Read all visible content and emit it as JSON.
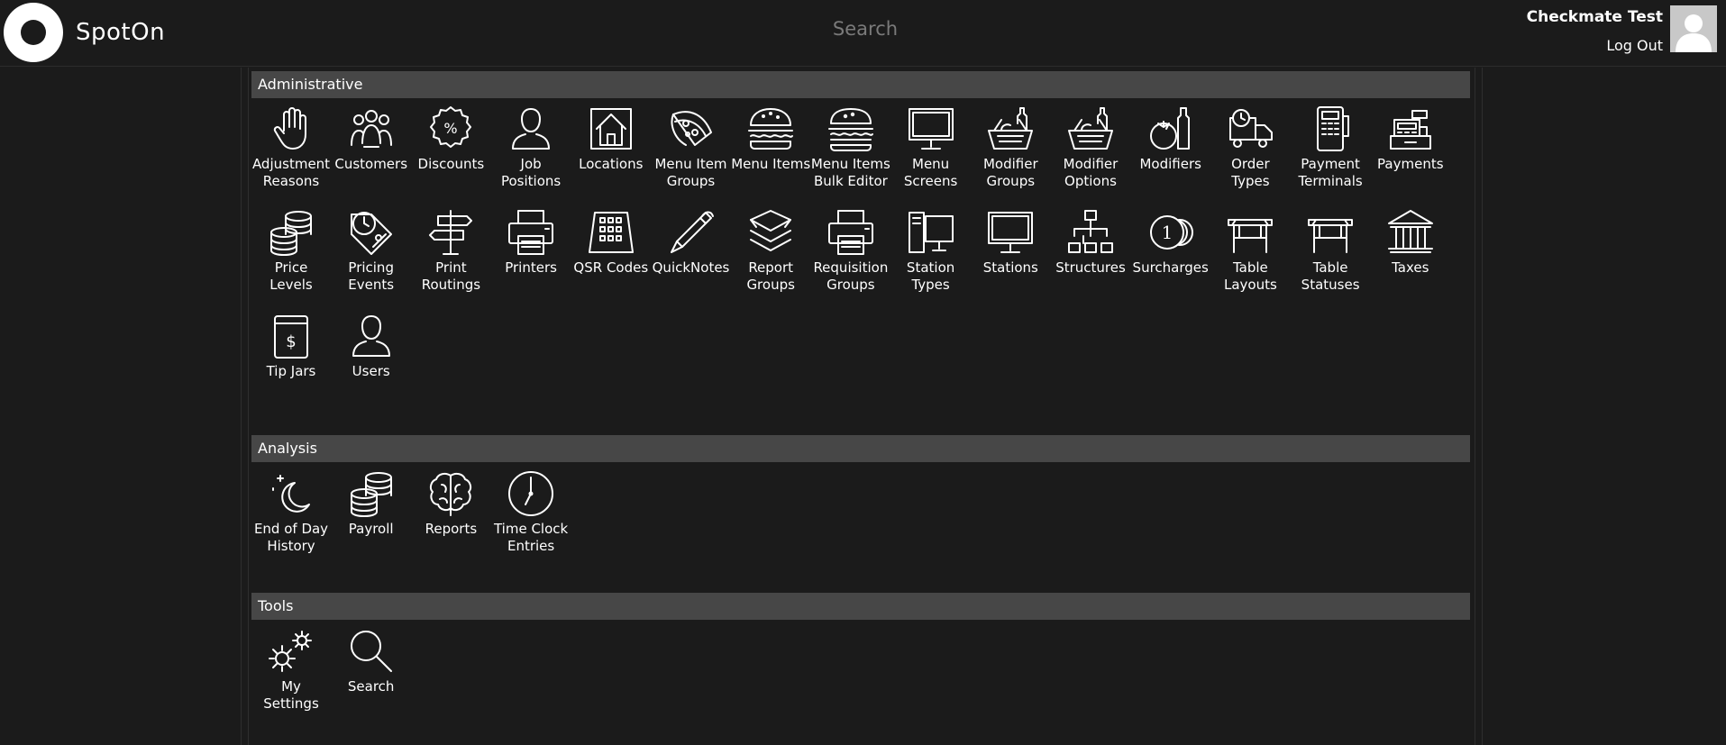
{
  "header": {
    "brand": "SpotOn",
    "search_placeholder": "Search",
    "user_name": "Checkmate Test",
    "logout_label": "Log Out"
  },
  "sections": {
    "administrative": {
      "title": "Administrative",
      "items": [
        {
          "label": "Adjustment\nReasons",
          "icon": "hand-icon"
        },
        {
          "label": "Customers",
          "icon": "customers-icon"
        },
        {
          "label": "Discounts",
          "icon": "discount-badge-icon"
        },
        {
          "label": "Job\nPositions",
          "icon": "person-icon"
        },
        {
          "label": "Locations",
          "icon": "house-icon"
        },
        {
          "label": "Menu Item\nGroups",
          "icon": "pizza-icon"
        },
        {
          "label": "Menu Items",
          "icon": "burger-icon"
        },
        {
          "label": "Menu Items\nBulk Editor",
          "icon": "burger-stack-icon"
        },
        {
          "label": "Menu\nScreens",
          "icon": "monitor-icon"
        },
        {
          "label": "Modifier\nGroups",
          "icon": "basket-bottle-icon"
        },
        {
          "label": "Modifier\nOptions",
          "icon": "basket-bottle-icon"
        },
        {
          "label": "Modifiers",
          "icon": "tomato-bottle-icon"
        },
        {
          "label": "Order Types",
          "icon": "delivery-truck-icon"
        },
        {
          "label": "Payment\nTerminals",
          "icon": "card-terminal-icon"
        },
        {
          "label": "Payments",
          "icon": "cash-register-icon"
        },
        {
          "label": "Price Levels",
          "icon": "coin-stack-icon"
        },
        {
          "label": "Pricing\nEvents",
          "icon": "price-tag-clock-icon"
        },
        {
          "label": "Print\nRoutings",
          "icon": "signpost-icon"
        },
        {
          "label": "Printers",
          "icon": "printer-icon"
        },
        {
          "label": "QSR Codes",
          "icon": "keypad-icon"
        },
        {
          "label": "QuickNotes",
          "icon": "pen-icon"
        },
        {
          "label": "Report\nGroups",
          "icon": "layers-icon"
        },
        {
          "label": "Requisition\nGroups",
          "icon": "printer-icon"
        },
        {
          "label": "Station\nTypes",
          "icon": "workstation-icon"
        },
        {
          "label": "Stations",
          "icon": "monitor-icon"
        },
        {
          "label": "Structures",
          "icon": "org-chart-icon"
        },
        {
          "label": "Surcharges",
          "icon": "coins-icon"
        },
        {
          "label": "Table\nLayouts",
          "icon": "table-icon"
        },
        {
          "label": "Table\nStatuses",
          "icon": "table-icon"
        },
        {
          "label": "Taxes",
          "icon": "bank-icon"
        },
        {
          "label": "Tip Jars",
          "icon": "tip-jar-icon"
        },
        {
          "label": "Users",
          "icon": "person-icon"
        }
      ]
    },
    "analysis": {
      "title": "Analysis",
      "items": [
        {
          "label": "End of Day\nHistory",
          "icon": "moon-icon"
        },
        {
          "label": "Payroll",
          "icon": "coin-stack-icon"
        },
        {
          "label": "Reports",
          "icon": "brain-icon"
        },
        {
          "label": "Time Clock\nEntries",
          "icon": "clock-icon"
        }
      ]
    },
    "tools": {
      "title": "Tools",
      "items": [
        {
          "label": "My Settings",
          "icon": "gears-icon"
        },
        {
          "label": "Search",
          "icon": "search-icon"
        }
      ]
    }
  }
}
